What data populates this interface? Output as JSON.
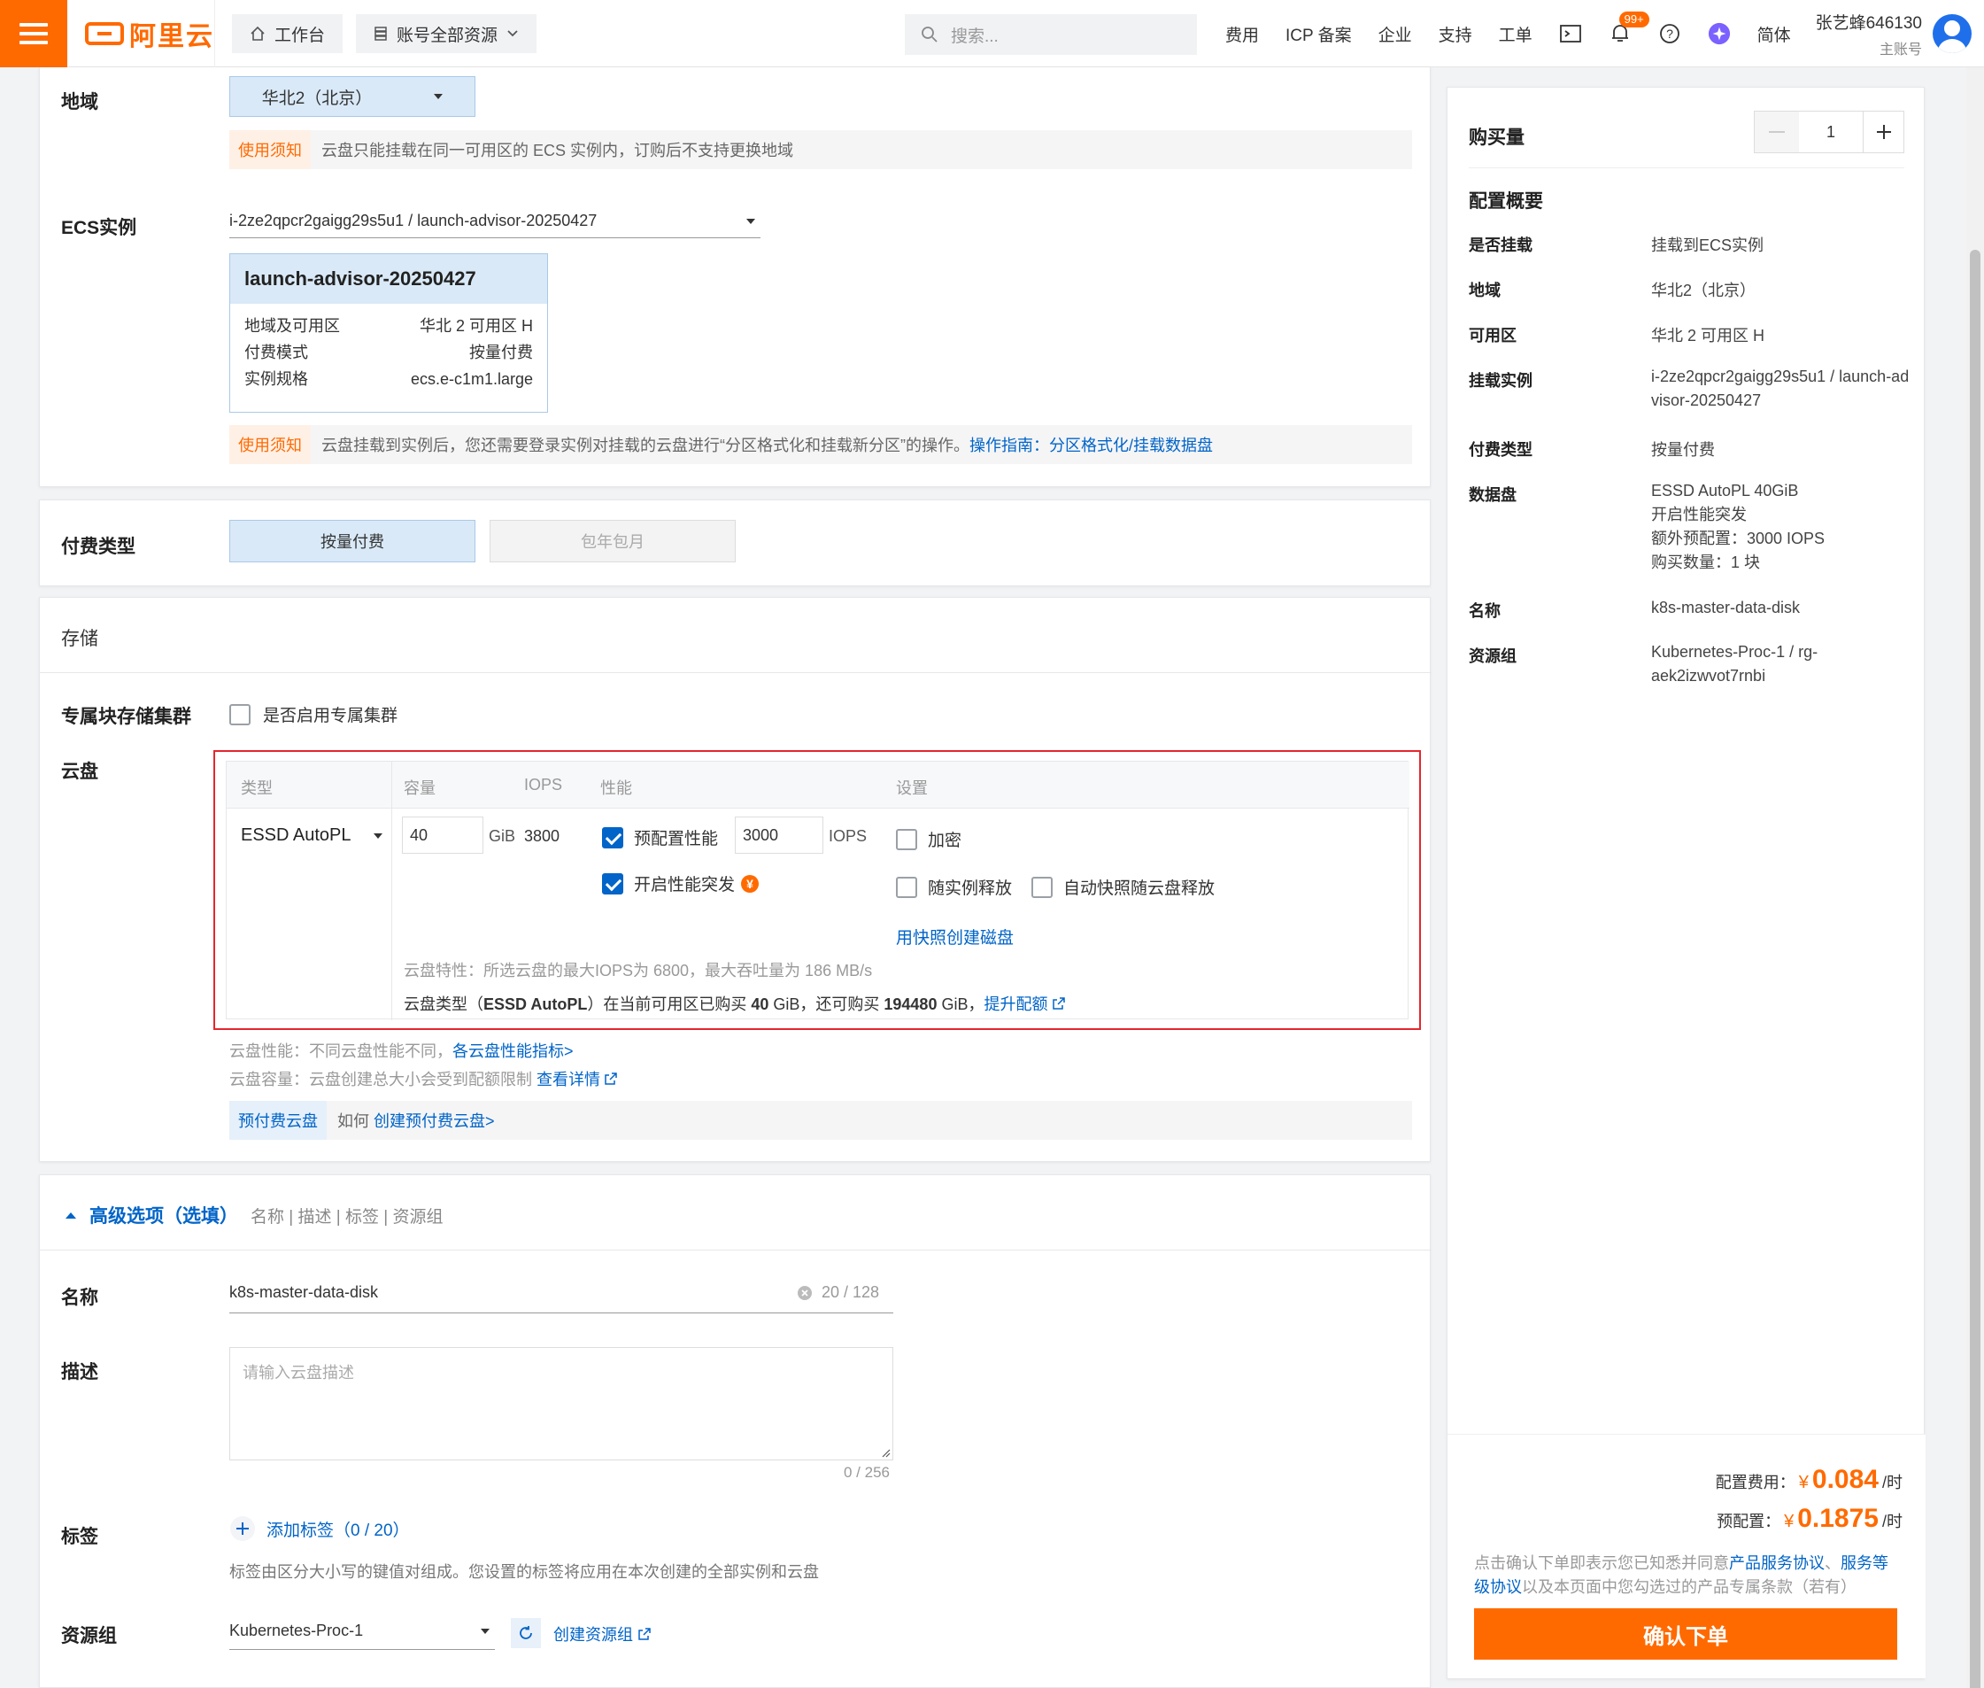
{
  "topbar": {
    "logo": "阿里云",
    "workbench": "工作台",
    "resources": "账号全部资源",
    "search_placeholder": "搜索...",
    "links": [
      "费用",
      "ICP 备案",
      "企业",
      "支持",
      "工单"
    ],
    "badge": "99+",
    "lang": "简体",
    "user_name": "张艺蜂646130",
    "user_sub": "主账号"
  },
  "region": {
    "label": "地域",
    "value": "华北2（北京）",
    "notice_tag": "使用须知",
    "notice_text": "云盘只能挂载在同一可用区的 ECS 实例内，订购后不支持更换地域"
  },
  "ecs": {
    "label": "ECS实例",
    "value": "i-2ze2qpcr2gaigg29s5u1 / launch-advisor-20250427",
    "card_title": "launch-advisor-20250427",
    "rows": [
      {
        "k": "地域及可用区",
        "v": "华北 2 可用区 H"
      },
      {
        "k": "付费模式",
        "v": "按量付费"
      },
      {
        "k": "实例规格",
        "v": "ecs.e-c1m1.large"
      }
    ],
    "notice_tag": "使用须知",
    "notice_text": "云盘挂载到实例后，您还需要登录实例对挂载的云盘进行“分区格式化和挂载新分区”的操作。",
    "notice_link": "操作指南：分区格式化/挂载数据盘"
  },
  "billing": {
    "label": "付费类型",
    "option1": "按量付费",
    "option2": "包年包月"
  },
  "storage": {
    "title": "存储",
    "cluster_label": "专属块存储集群",
    "cluster_checkbox": "是否启用专属集群",
    "disk_label": "云盘",
    "headers": {
      "type": "类型",
      "capacity": "容量",
      "iops": "IOPS",
      "perf": "性能",
      "settings": "设置"
    },
    "type_value": "ESSD AutoPL",
    "capacity_value": "40",
    "unit": "GiB",
    "iops_value": "3800",
    "provision_label": "预配置性能",
    "provision_value": "3000",
    "provision_unit": "IOPS",
    "burst_label": "开启性能突发",
    "encrypt": "加密",
    "release_with_instance": "随实例释放",
    "auto_snapshot": "自动快照随云盘释放",
    "snapshot_link": "用快照创建磁盘",
    "feature_text": "云盘特性：所选云盘的最大IOPS为 6800，最大吞吐量为 186 MB/s",
    "quota_text_1": "云盘类型（",
    "quota_type": "ESSD AutoPL",
    "quota_text_2": "）在当前可用区已购买 ",
    "quota_bought": "40",
    "quota_text_3": " GiB，还可购买 ",
    "quota_left": "194480",
    "quota_text_4": " GiB，",
    "quota_link": "提升配额",
    "perf_note": "云盘性能：不同云盘性能不同，",
    "perf_link": "各云盘性能指标>",
    "cap_note": "云盘容量：云盘创建总大小会受到配额限制",
    "cap_link": "查看详情",
    "prepaid_tag": "预付费云盘",
    "prepaid_text": "如何",
    "prepaid_link": "创建预付费云盘>"
  },
  "advanced": {
    "title": "高级选项（选填）",
    "subtitle": "名称 | 描述 | 标签 | 资源组",
    "name_label": "名称",
    "name_value": "k8s-master-data-disk",
    "name_count": "20 / 128",
    "desc_label": "描述",
    "desc_placeholder": "请输入云盘描述",
    "desc_count": "0 / 256",
    "tag_label": "标签",
    "tag_link": "添加标签（0 / 20）",
    "tag_note": "标签由区分大小写的键值对组成。您设置的标签将应用在本次创建的全部实例和云盘",
    "rg_label": "资源组",
    "rg_value": "Kubernetes-Proc-1",
    "rg_link": "创建资源组"
  },
  "summary": {
    "qty_label": "购买量",
    "qty_value": "1",
    "overview": "配置概要",
    "rows": [
      {
        "k": "是否挂载",
        "v": "挂载到ECS实例"
      },
      {
        "k": "地域",
        "v": "华北2（北京）"
      },
      {
        "k": "可用区",
        "v": "华北 2 可用区 H"
      },
      {
        "k": "挂载实例",
        "v": "i-2ze2qpcr2gaigg29s5u1 / launch-advisor-20250427"
      },
      {
        "k": "付费类型",
        "v": "按量付费"
      },
      {
        "k": "数据盘",
        "v": "ESSD AutoPL 40GiB\n开启性能突发\n额外预配置：3000 IOPS\n购买数量：1 块"
      },
      {
        "k": "名称",
        "v": "k8s-master-data-disk"
      },
      {
        "k": "资源组",
        "v": "Kubernetes-Proc-1 / rg-aek2izwvot7rnbi"
      }
    ],
    "cost_label": "配置费用：",
    "cost_currency": "¥",
    "cost_value": "0.084",
    "cost_unit": "/时",
    "pre_label": "预配置：",
    "pre_currency": "¥",
    "pre_value": "0.1875",
    "pre_unit": "/时",
    "agree_1": "点击确认下单即表示您已知悉并同意",
    "agree_link1": "产品服务协议",
    "agree_sep": "、",
    "agree_link2": "服务等级协议",
    "agree_2": "以及本页面中您勾选过的产品专属条款（若有）",
    "confirm": "确认下单"
  },
  "colors": {
    "brand": "#ff6a00",
    "link": "#0064c8",
    "highlight_border": "#e5262e"
  }
}
